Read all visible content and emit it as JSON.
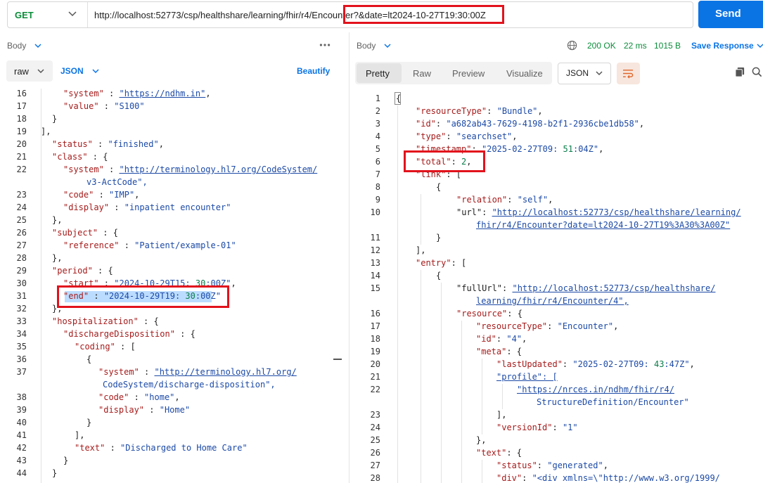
{
  "request": {
    "method": "GET",
    "url": "http://localhost:52773/csp/healthshare/learning/fhir/r4/Encounter?&date=lt2024-10-27T19:30:00Z",
    "send_label": "Send"
  },
  "left": {
    "body_label": "Body",
    "mode": "raw",
    "format": "JSON",
    "beautify_label": "Beautify"
  },
  "right": {
    "body_label": "Body",
    "status_code": "200 OK",
    "time": "22 ms",
    "size": "1015 B",
    "save_label": "Save Response",
    "tabs": [
      "Pretty",
      "Raw",
      "Preview",
      "Visualize"
    ],
    "format": "JSON"
  },
  "highlight_color": "#e2121c",
  "left_code": [
    {
      "ln": "16",
      "text": "\"system\" : \"https://ndhm.in\","
    },
    {
      "ln": "17",
      "text": "\"value\" : \"S100\""
    },
    {
      "ln": "18",
      "text": "}"
    },
    {
      "ln": "19",
      "text": "],"
    },
    {
      "ln": "20",
      "text": "\"status\" : \"finished\","
    },
    {
      "ln": "21",
      "text": "\"class\" : {"
    },
    {
      "ln": "22",
      "text": "\"system\" : \"http://terminology.hl7.org/CodeSystem/"
    },
    {
      "ln": "",
      "text": "v3-ActCode\","
    },
    {
      "ln": "23",
      "text": "\"code\" : \"IMP\","
    },
    {
      "ln": "24",
      "text": "\"display\" : \"inpatient encounter\""
    },
    {
      "ln": "25",
      "text": "},"
    },
    {
      "ln": "26",
      "text": "\"subject\" : {"
    },
    {
      "ln": "27",
      "text": "\"reference\" : \"Patient/example-01\""
    },
    {
      "ln": "28",
      "text": "},"
    },
    {
      "ln": "29",
      "text": "\"period\" : {"
    },
    {
      "ln": "30",
      "text": "\"start\" : \"2024-10-29T15:30:00Z\","
    },
    {
      "ln": "31",
      "text": "\"end\" : \"2024-10-29T19:30:00Z\""
    },
    {
      "ln": "32",
      "text": "},"
    },
    {
      "ln": "33",
      "text": "\"hospitalization\" : {"
    },
    {
      "ln": "34",
      "text": "\"dischargeDisposition\" : {"
    },
    {
      "ln": "35",
      "text": "\"coding\" : ["
    },
    {
      "ln": "36",
      "text": "{"
    },
    {
      "ln": "37",
      "text": "\"system\" : \"http://terminology.hl7.org/"
    },
    {
      "ln": "",
      "text": "CodeSystem/discharge-disposition\","
    },
    {
      "ln": "38",
      "text": "\"code\" : \"home\","
    },
    {
      "ln": "39",
      "text": "\"display\" : \"Home\""
    },
    {
      "ln": "40",
      "text": "}"
    },
    {
      "ln": "41",
      "text": "],"
    },
    {
      "ln": "42",
      "text": "\"text\" : \"Discharged to Home Care\""
    },
    {
      "ln": "43",
      "text": "}"
    },
    {
      "ln": "44",
      "text": "}"
    }
  ],
  "right_code": [
    {
      "ln": "1",
      "text": "{"
    },
    {
      "ln": "2",
      "text": "\"resourceType\": \"Bundle\","
    },
    {
      "ln": "3",
      "text": "\"id\": \"a682ab43-7629-4198-b2f1-2936cbe1db58\","
    },
    {
      "ln": "4",
      "text": "\"type\": \"searchset\","
    },
    {
      "ln": "5",
      "text": "\"timestamp\": \"2025-02-27T09:51:04Z\","
    },
    {
      "ln": "6",
      "text": "\"total\": 2,"
    },
    {
      "ln": "7",
      "text": "\"link\": ["
    },
    {
      "ln": "8",
      "text": "{"
    },
    {
      "ln": "9",
      "text": "\"relation\": \"self\","
    },
    {
      "ln": "10",
      "text": "\"url\": \"http://localhost:52773/csp/healthshare/learning/"
    },
    {
      "ln": "",
      "text": "fhir/r4/Encounter?date=lt2024-10-27T19%3A30%3A00Z\""
    },
    {
      "ln": "11",
      "text": "}"
    },
    {
      "ln": "12",
      "text": "],"
    },
    {
      "ln": "13",
      "text": "\"entry\": ["
    },
    {
      "ln": "14",
      "text": "{"
    },
    {
      "ln": "15",
      "text": "\"fullUrl\": \"http://localhost:52773/csp/healthshare/"
    },
    {
      "ln": "",
      "text": "learning/fhir/r4/Encounter/4\","
    },
    {
      "ln": "16",
      "text": "\"resource\": {"
    },
    {
      "ln": "17",
      "text": "\"resourceType\": \"Encounter\","
    },
    {
      "ln": "18",
      "text": "\"id\": \"4\","
    },
    {
      "ln": "19",
      "text": "\"meta\": {"
    },
    {
      "ln": "20",
      "text": "\"lastUpdated\": \"2025-02-27T09:43:47Z\","
    },
    {
      "ln": "21",
      "text": "\"profile\": ["
    },
    {
      "ln": "22",
      "text": "\"https://nrces.in/ndhm/fhir/r4/"
    },
    {
      "ln": "",
      "text": "StructureDefinition/Encounter\""
    },
    {
      "ln": "23",
      "text": "],"
    },
    {
      "ln": "24",
      "text": "\"versionId\": \"1\""
    },
    {
      "ln": "25",
      "text": "},"
    },
    {
      "ln": "26",
      "text": "\"text\": {"
    },
    {
      "ln": "27",
      "text": "\"status\": \"generated\","
    },
    {
      "ln": "28",
      "text": "\"div\": \"<div xmlns=\\\"http://www.w3.org/1999/"
    }
  ]
}
